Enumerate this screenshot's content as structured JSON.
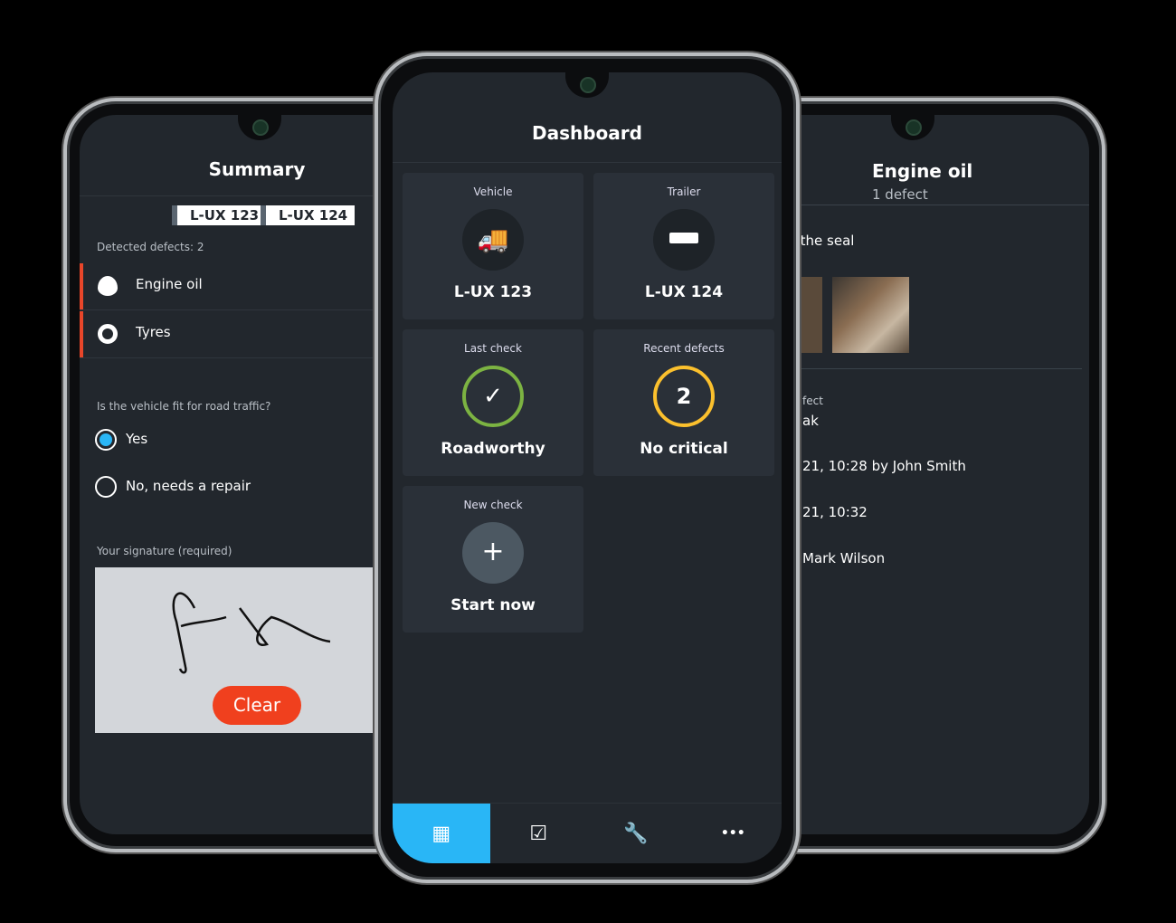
{
  "summary": {
    "title": "Summary",
    "plates": [
      "L-UX 123",
      "L-UX 124"
    ],
    "detected": "Detected defects: 2",
    "defects": [
      {
        "label": "Engine oil",
        "icon": "oil-drop-icon"
      },
      {
        "label": "Tyres",
        "icon": "tyre-icon"
      }
    ],
    "question": "Is the vehicle fit for road traffic?",
    "options": [
      "Yes",
      "No, needs a repair"
    ],
    "selected": "Yes",
    "signature_label": "Your signature (required)",
    "clear": "Clear"
  },
  "dashboard": {
    "title": "Dashboard",
    "cards": [
      {
        "label": "Vehicle",
        "value": "L-UX 123",
        "icon": "truck-icon"
      },
      {
        "label": "Trailer",
        "value": "L-UX 124",
        "icon": "trailer-icon"
      },
      {
        "label": "Last check",
        "value": "Roadworthy",
        "icon": "check-icon"
      },
      {
        "label": "Recent defects",
        "value": "No critical",
        "count": "2"
      },
      {
        "label": "New check",
        "value": "Start now",
        "icon": "plus-icon"
      }
    ],
    "nav": [
      {
        "icon": "grid-icon",
        "glyph": "▦",
        "active": true
      },
      {
        "icon": "checklist-icon",
        "glyph": "☑"
      },
      {
        "icon": "wrench-icon",
        "glyph": "🔧"
      },
      {
        "icon": "more-icon",
        "glyph": "•••"
      }
    ]
  },
  "detail": {
    "title": "Engine oil",
    "subtitle": "1 defect",
    "text1": "t the seal",
    "label1": "fect",
    "text2": "ak",
    "text3": "21, 10:28 by John Smith",
    "text4": "21, 10:32",
    "text5": "Mark Wilson"
  },
  "colors": {
    "accent": "#29b6f6",
    "danger": "#e8462a",
    "ok": "#7cb342",
    "warn": "#fbc02d",
    "screen": "#22272d"
  }
}
